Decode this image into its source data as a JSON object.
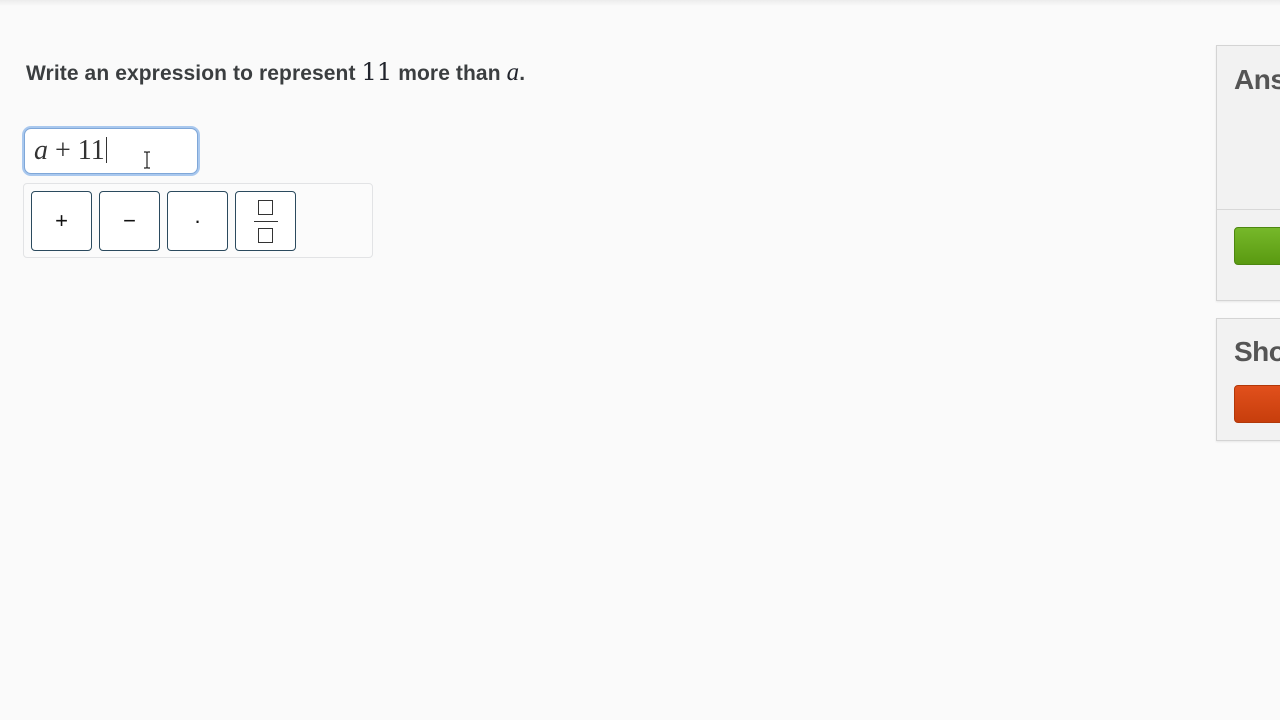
{
  "question": {
    "prefix": "Write an expression to represent ",
    "number": "11",
    "middle": " more than ",
    "variable": "a",
    "suffix": "."
  },
  "answer_input": {
    "variable": "a",
    "operator": " + ",
    "number": "11"
  },
  "keypad": {
    "plus_label": "+",
    "minus_label": "−",
    "dot_label": "·"
  },
  "side_panel": {
    "answer_title": "Ans",
    "hint_title": "Sho"
  },
  "colors": {
    "accent_green": "#5a9a11",
    "accent_red": "#c73e0c",
    "focus_blue": "#7fa7d8"
  }
}
